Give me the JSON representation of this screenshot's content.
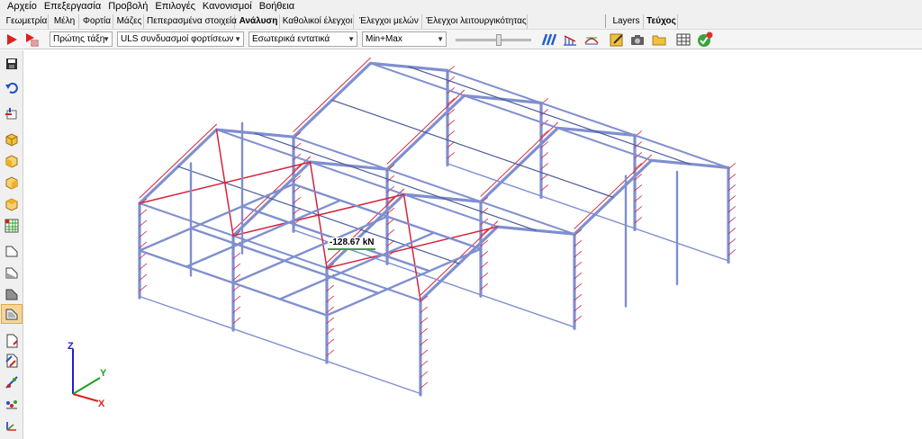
{
  "menu": [
    "Αρχείο",
    "Επεξεργασία",
    "Προβολή",
    "Επιλογές",
    "Κανονισμοί",
    "Βοήθεια"
  ],
  "tabs": [
    {
      "label": "Γεωμετρία"
    },
    {
      "label": "Μέλη"
    },
    {
      "label": "Φορτία"
    },
    {
      "label": "Μάζες"
    },
    {
      "label": "Πεπερασμένα στοιχεία"
    },
    {
      "label": "Ανάλυση",
      "active": true
    },
    {
      "label": "Καθολικοί έλεγχοι"
    },
    {
      "label": "Έλεγχοι μελών"
    },
    {
      "label": "Έλεγχοι λειτουργικότητας"
    }
  ],
  "right_tabs": [
    {
      "label": "Layers"
    },
    {
      "label": "Τεύχος",
      "active": true
    }
  ],
  "toolbar": {
    "order_combo": "Πρώτης τάξη",
    "combination_combo": "ULS συνδυασμοί φορτίσεων",
    "result_combo": "Εσωτερικά εντατικά",
    "envelope_combo": "Min+Max"
  },
  "viewport": {
    "result_label": "-128.67 kN",
    "axes": {
      "x": "X",
      "y": "Y",
      "z": "Z"
    }
  },
  "colors": {
    "member": "#7f8fcf",
    "member_dark": "#4a5a9a",
    "diagram_red": "#d4243c",
    "axis_x": "#e02020",
    "axis_y": "#20a020",
    "axis_z": "#2020d0"
  }
}
